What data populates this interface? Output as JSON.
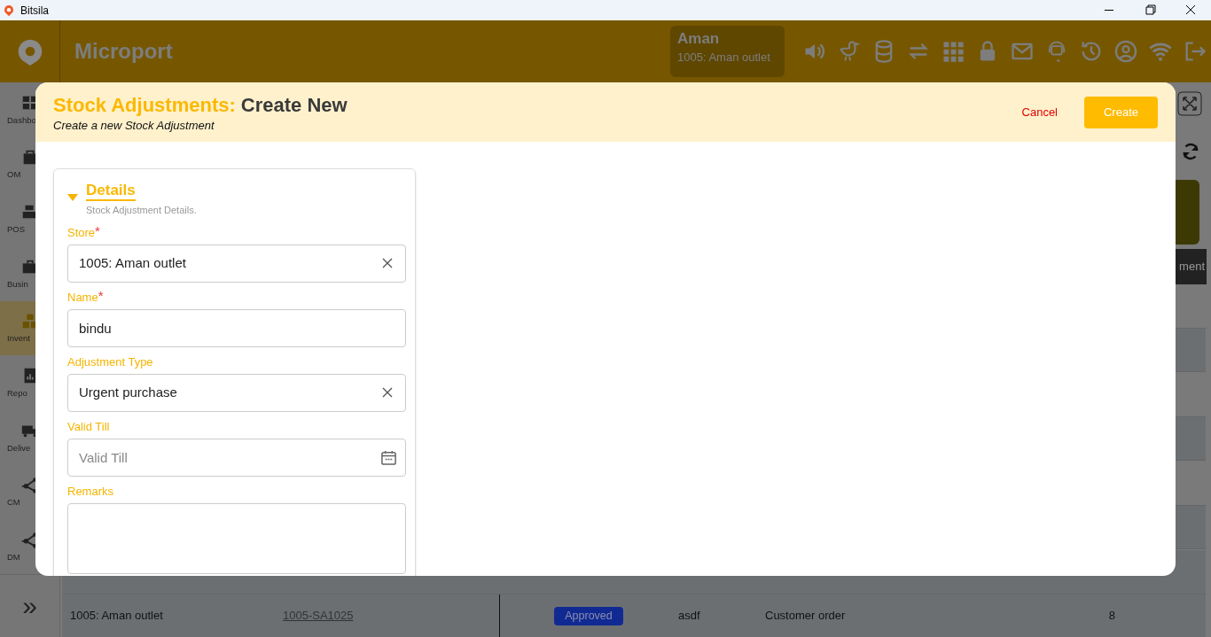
{
  "window": {
    "title": "Bitsila"
  },
  "app": {
    "name": "Microport",
    "user": {
      "name": "Aman",
      "store": "1005: Aman outlet"
    }
  },
  "sidebar": {
    "items": [
      {
        "label": "Dashbo",
        "selected": false
      },
      {
        "label": "OM",
        "selected": false
      },
      {
        "label": "POS",
        "selected": false
      },
      {
        "label": "Busin",
        "selected": false
      },
      {
        "label": "Invent",
        "selected": true
      },
      {
        "label": "Repo",
        "selected": false
      },
      {
        "label": "Delive",
        "selected": false
      },
      {
        "label": "CM",
        "selected": false
      },
      {
        "label": "DM",
        "selected": false
      }
    ],
    "expand": "»"
  },
  "background": {
    "button": "ment",
    "row": {
      "store": "1005: Aman outlet",
      "code": "1005-SA1025",
      "status": "Approved",
      "name": "asdf",
      "type": "Customer order",
      "quantity": "8"
    }
  },
  "modal": {
    "title_prefix": "Stock Adjustments:",
    "title": "Create New",
    "subtitle": "Create a new Stock Adjustment",
    "cancel": "Cancel",
    "create": "Create",
    "section": {
      "title": "Details",
      "subtitle": "Stock Adjustment Details.",
      "expanded": true,
      "fields": [
        {
          "kind": "select",
          "label": "Store",
          "required_mark": "*",
          "value": "1005: Aman outlet"
        },
        {
          "kind": "text",
          "label": "Name",
          "required_mark": "*",
          "value": "bindu"
        },
        {
          "kind": "select",
          "label": "Adjustment Type",
          "value": "Urgent purchase"
        },
        {
          "kind": "date",
          "label": "Valid Till",
          "placeholder": "Valid Till"
        },
        {
          "kind": "textarea",
          "label": "Remarks"
        }
      ]
    }
  }
}
